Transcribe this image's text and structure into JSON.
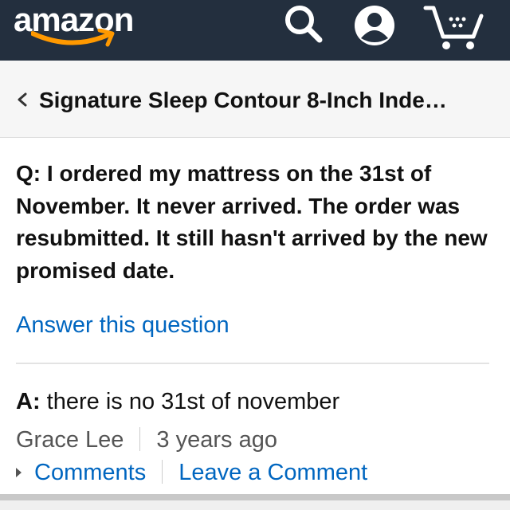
{
  "header": {
    "logo_text": "amazon",
    "icons": [
      "search-icon",
      "account-icon",
      "cart-icon"
    ],
    "colors": {
      "background": "#232f3e",
      "logo_smile": "#ff9900"
    }
  },
  "breadcrumb": {
    "back_icon": "chevron-left-icon",
    "title": "Signature Sleep Contour 8-Inch Inde…"
  },
  "question": {
    "text": "Q: I ordered my mattress on the 31st of November. It never arrived. The order was resubmitted. It still hasn't arrived by the new promised date."
  },
  "answer_link": "Answer this question",
  "answer": {
    "prefix": "A:",
    "text": " there is no 31st of november",
    "author": "Grace Lee",
    "time": "3 years ago",
    "comments_label": "Comments",
    "leave_comment_label": "Leave a Comment"
  },
  "colors": {
    "link": "#0066c0",
    "text": "#111111",
    "meta": "#555555"
  }
}
